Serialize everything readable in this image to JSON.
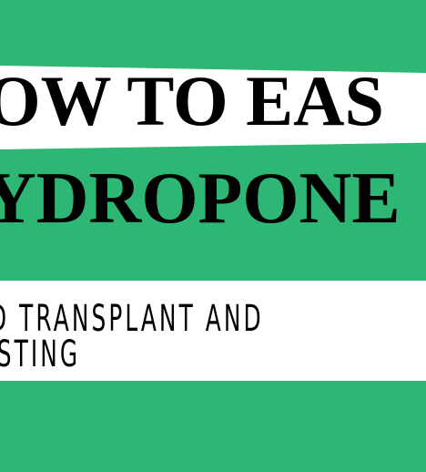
{
  "headline": {
    "line1": "OW TO EAS",
    "line2": "YDROPONE"
  },
  "subheadline": {
    "line1": "D TRANSPLANT AND",
    "line2": "ESTING"
  },
  "colors": {
    "background": "#2eb774",
    "band": "#ffffff",
    "text": "#000000"
  }
}
